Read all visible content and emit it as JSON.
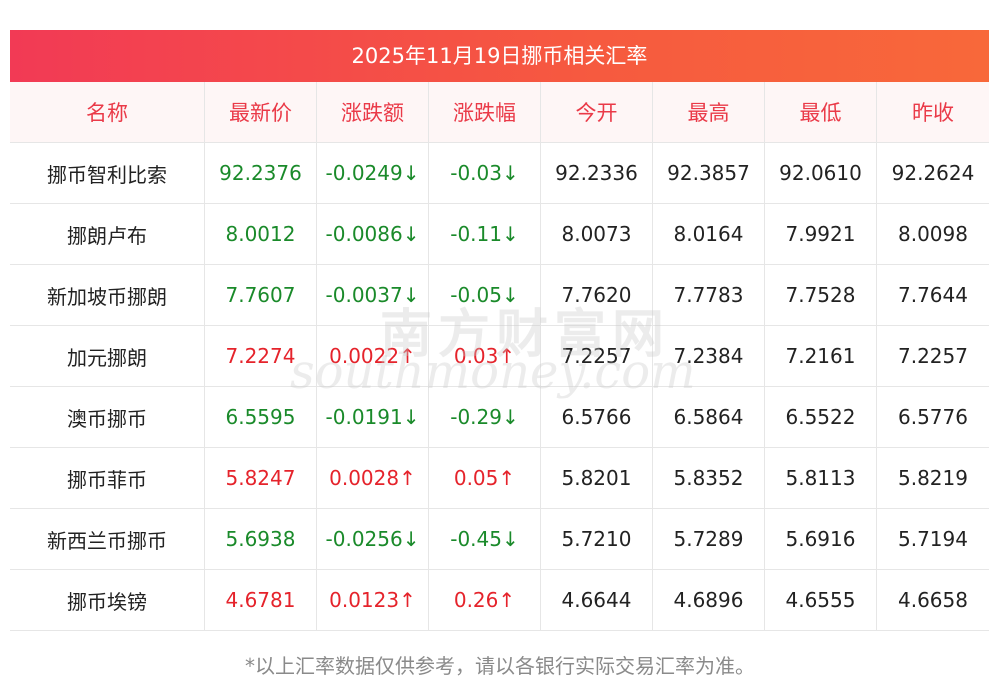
{
  "title": "2025年11月19日挪币相关汇率",
  "columns": [
    "名称",
    "最新价",
    "涨跌额",
    "涨跌幅",
    "今开",
    "最高",
    "最低",
    "昨收"
  ],
  "rows": [
    {
      "name": "挪币智利比索",
      "latest": "92.2376",
      "change": "-0.0249↓",
      "pct": "-0.03↓",
      "open": "92.2336",
      "high": "92.3857",
      "low": "92.0610",
      "prev": "92.2624",
      "dir": "down"
    },
    {
      "name": "挪朗卢布",
      "latest": "8.0012",
      "change": "-0.0086↓",
      "pct": "-0.11↓",
      "open": "8.0073",
      "high": "8.0164",
      "low": "7.9921",
      "prev": "8.0098",
      "dir": "down"
    },
    {
      "name": "新加坡币挪朗",
      "latest": "7.7607",
      "change": "-0.0037↓",
      "pct": "-0.05↓",
      "open": "7.7620",
      "high": "7.7783",
      "low": "7.7528",
      "prev": "7.7644",
      "dir": "down"
    },
    {
      "name": "加元挪朗",
      "latest": "7.2274",
      "change": "0.0022↑",
      "pct": "0.03↑",
      "open": "7.2257",
      "high": "7.2384",
      "low": "7.2161",
      "prev": "7.2257",
      "dir": "up"
    },
    {
      "name": "澳币挪币",
      "latest": "6.5595",
      "change": "-0.0191↓",
      "pct": "-0.29↓",
      "open": "6.5766",
      "high": "6.5864",
      "low": "6.5522",
      "prev": "6.5776",
      "dir": "down"
    },
    {
      "name": "挪币菲币",
      "latest": "5.8247",
      "change": "0.0028↑",
      "pct": "0.05↑",
      "open": "5.8201",
      "high": "5.8352",
      "low": "5.8113",
      "prev": "5.8219",
      "dir": "up"
    },
    {
      "name": "新西兰币挪币",
      "latest": "5.6938",
      "change": "-0.0256↓",
      "pct": "-0.45↓",
      "open": "5.7210",
      "high": "5.7289",
      "low": "5.6916",
      "prev": "5.7194",
      "dir": "down"
    },
    {
      "name": "挪币埃镑",
      "latest": "4.6781",
      "change": "0.0123↑",
      "pct": "0.26↑",
      "open": "4.6644",
      "high": "4.6896",
      "low": "4.6555",
      "prev": "4.6658",
      "dir": "up"
    }
  ],
  "footnote": "*以上汇率数据仅供参考，请以各银行实际交易汇率为准。",
  "watermark": {
    "cn": "南方财富网",
    "en": "southmoney.com"
  },
  "colors": {
    "up": "#e5232b",
    "down": "#1a8a2a",
    "header_text": "#ea3a48",
    "title_bar": "#f4474b"
  }
}
